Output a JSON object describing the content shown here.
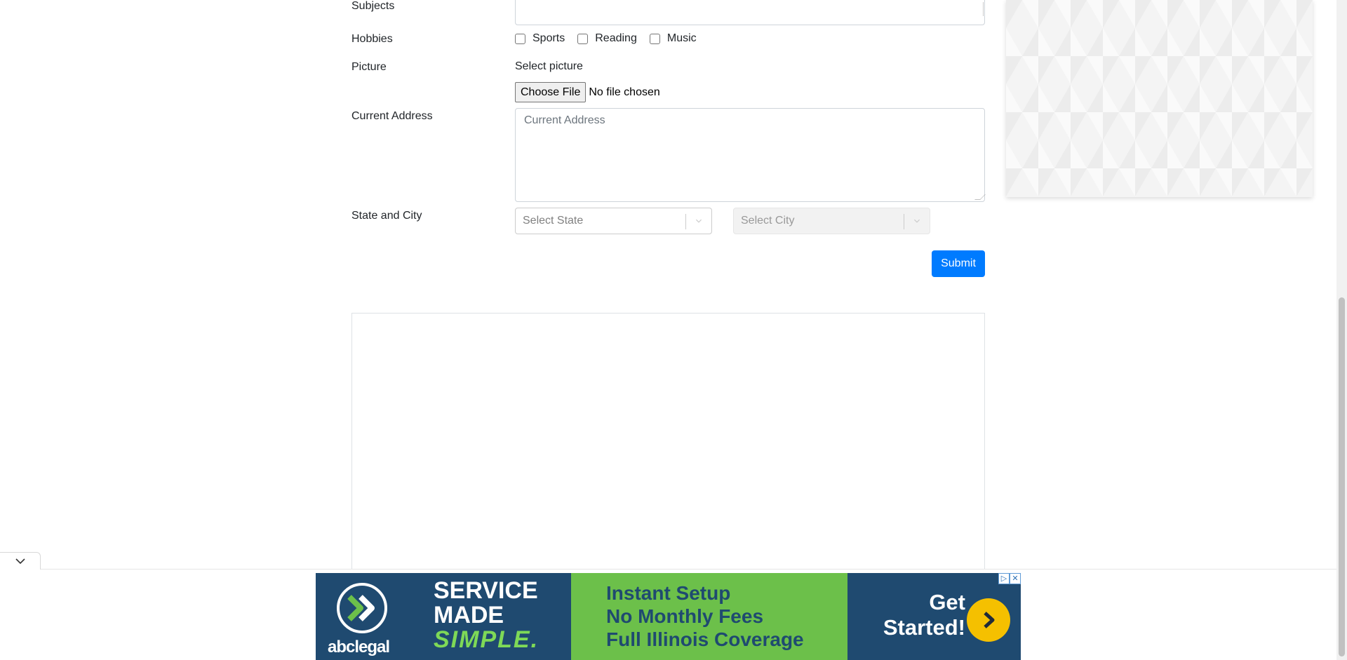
{
  "form": {
    "subjects_label": "Subjects",
    "hobbies_label": "Hobbies",
    "hobbies": [
      "Sports",
      "Reading",
      "Music"
    ],
    "picture_label": "Picture",
    "select_picture_label": "Select picture",
    "choose_file_label": "Choose File",
    "file_status": "No file chosen",
    "address_label": "Current Address",
    "address_placeholder": "Current Address",
    "state_city_label": "State and City",
    "state_placeholder": "Select State",
    "city_placeholder": "Select City",
    "submit_label": "Submit"
  },
  "ad": {
    "brand": "abclegal",
    "headline_line1": "SERVICE",
    "headline_line2": "MADE",
    "headline_line3": "SIMPLE.",
    "features": [
      "Instant Setup",
      "No Monthly Fees",
      "Full Illinois Coverage"
    ],
    "cta_line1": "Get",
    "cta_line2": "Started!",
    "colors": {
      "dark_blue": "#1f4a70",
      "green": "#6cc04a",
      "accent_green": "#7ed957",
      "cta_yellow": "#f5c000"
    }
  },
  "icons": {
    "collapse": "chevron-down-icon",
    "select_indicator": "chevron-down-icon",
    "ad_choices": "ad-choices-icon",
    "ad_close": "close-icon"
  },
  "colors": {
    "primary": "#007bff",
    "border": "#ced4da"
  }
}
